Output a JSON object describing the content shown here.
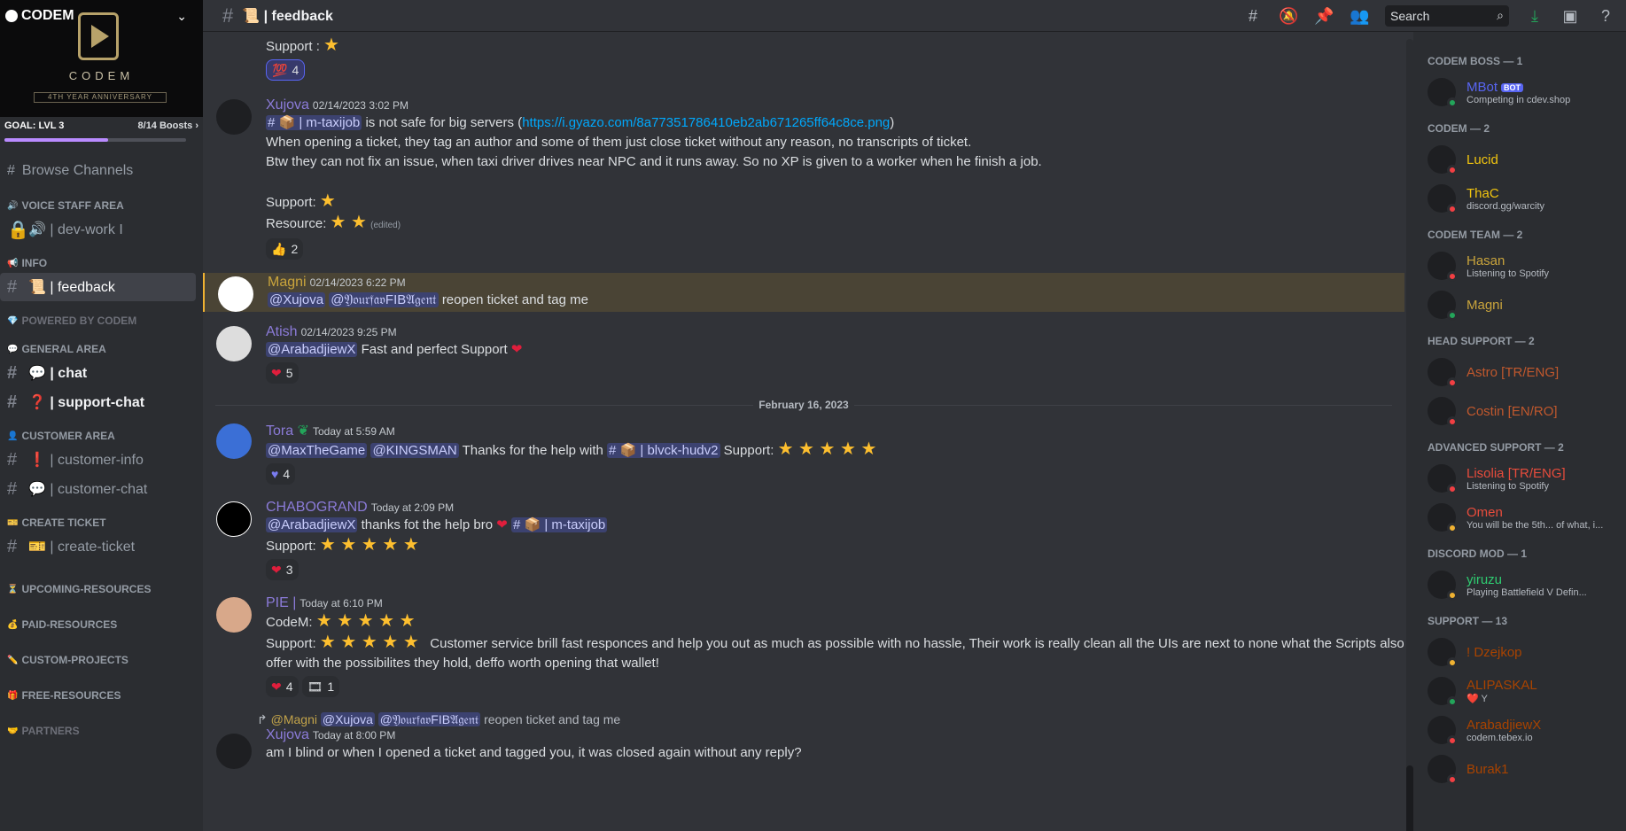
{
  "server": {
    "name": "CODEM",
    "logo_text": "CODEM",
    "logo_sub": "4TH YEAR ANNIVERSARY",
    "goal_label": "GOAL: LVL 3",
    "boosts": "8/14 Boosts",
    "goal_progress": 0.571
  },
  "sidebar": {
    "browse": "Browse Channels",
    "items": [
      {
        "type": "cat",
        "label": "VOICE STAFF AREA"
      },
      {
        "type": "chan",
        "label": "🔊 | dev-work I"
      },
      {
        "type": "cat",
        "label": "INFO"
      },
      {
        "type": "chan",
        "label": "📜 | feedback"
      },
      {
        "type": "cat",
        "label": "POWERED BY CODEM"
      },
      {
        "type": "cat",
        "label": "GENERAL AREA"
      },
      {
        "type": "chan",
        "label": "💬 | chat"
      },
      {
        "type": "chan",
        "label": "❓ | support-chat"
      },
      {
        "type": "cat",
        "label": "CUSTOMER AREA"
      },
      {
        "type": "chan",
        "label": "❗ | customer-info"
      },
      {
        "type": "chan",
        "label": "💬 | customer-chat"
      },
      {
        "type": "cat",
        "label": "CREATE TICKET"
      },
      {
        "type": "chan",
        "label": "🎫 | create-ticket"
      },
      {
        "type": "cat",
        "label": "UPCOMING-RESOURCES"
      },
      {
        "type": "cat",
        "label": "PAID-RESOURCES"
      },
      {
        "type": "cat",
        "label": "CUSTOM-PROJECTS"
      },
      {
        "type": "cat",
        "label": "FREE-RESOURCES"
      },
      {
        "type": "cat",
        "label": "PARTNERS"
      }
    ]
  },
  "header": {
    "channel": "📜 | feedback",
    "search_placeholder": "Search"
  },
  "messages": {
    "top_support": "Support :",
    "top_react_count": "4",
    "m1": {
      "author": "Xujova",
      "time": "02/14/2023 3:02 PM",
      "chan": "📦 | m-taxijob",
      "l1a": "is not safe for big servers (",
      "link": "https://i.gyazo.com/8a77351786410eb2ab671265ff64c8ce.png",
      "l1b": ")",
      "l2": "When opening a ticket, they tag an author and some of them just close ticket without any reason, no transcripts of ticket.",
      "l3": "Btw they can not fix an issue, when taxi driver drives near NPC and it runs away. So no XP is given to a worker when he finish a job.",
      "support": "Support:",
      "resource": "Resource:",
      "edited": "(edited)",
      "react": "2"
    },
    "m2": {
      "author": "Magni",
      "time": "02/14/2023 6:22 PM",
      "mention1": "@Xujova",
      "mention2": "@𝔜𝔬𝔲𝔯𝔣𝔞𝔳FIB𝔄𝔤𝔢𝔫𝔱",
      "text": "reopen ticket and tag me"
    },
    "m3": {
      "author": "Atish",
      "time": "02/14/2023 9:25 PM",
      "mention": "@ArabadjiewX",
      "text": "Fast and perfect Support",
      "react": "5"
    },
    "divider": "February 16, 2023",
    "m4": {
      "author": "Tora",
      "time": "Today at 5:59 AM",
      "mention1": "@MaxTheGame",
      "mention2": "@KINGSMAN",
      "text": "Thanks for the help with",
      "chan": "📦 | blvck-hudv2",
      "support": "Support:",
      "react": "4"
    },
    "m5": {
      "author": "CHABOGRAND",
      "time": "Today at 2:09 PM",
      "mention": "@ArabadjiewX",
      "text": "thanks fot the help bro",
      "chan": "📦 | m-taxijob",
      "support": "Support:",
      "react": "3"
    },
    "m6": {
      "author": "PIE |",
      "time": "Today at 6:10 PM",
      "codem": "CodeM:",
      "support": "Support:",
      "text": "Customer service brill  fast responces and help you out as much as possible with no hassle, Their work is really clean all the UIs are next to none what the Scripts also offer with the possibilites they hold, deffo worth opening that wallet!",
      "react1": "4",
      "react2": "1"
    },
    "m7": {
      "reply_author": "@Magni",
      "reply_m1": "@Xujova",
      "reply_m2": "@𝔜𝔬𝔲𝔯𝔣𝔞𝔳FIB𝔄𝔤𝔢𝔫𝔱",
      "reply_text": "reopen ticket and tag me",
      "author": "Xujova",
      "time": "Today at 8:00 PM",
      "text": "am I blind or when I opened a ticket and tagged you, it was closed again without any reply?"
    }
  },
  "members": [
    {
      "cat": "CODEM BOSS — 1",
      "list": [
        {
          "name": "MBot",
          "color": "#5865f2",
          "bot": "BOT",
          "act": "Competing in cdev.shop",
          "status": "online"
        }
      ]
    },
    {
      "cat": "CODEM — 2",
      "list": [
        {
          "name": "Lucid",
          "color": "#f1c40f",
          "act": "",
          "status": "dnd"
        },
        {
          "name": "ThaC",
          "color": "#f1c40f",
          "act": "discord.gg/warcity",
          "status": "dnd"
        }
      ]
    },
    {
      "cat": "CODEM TEAM — 2",
      "list": [
        {
          "name": "Hasan",
          "color": "#c9a43c",
          "act": "Listening to Spotify",
          "status": "dnd"
        },
        {
          "name": "Magni",
          "color": "#c9a43c",
          "act": "",
          "status": "online"
        }
      ]
    },
    {
      "cat": "HEAD SUPPORT — 2",
      "list": [
        {
          "name": "Astro [TR/ENG]",
          "color": "#c0582d",
          "act": "",
          "status": "dnd"
        },
        {
          "name": "Costin [EN/RO]",
          "color": "#c0582d",
          "act": "",
          "status": "dnd"
        }
      ]
    },
    {
      "cat": "ADVANCED SUPPORT — 2",
      "list": [
        {
          "name": "Lisolia [TR/ENG]",
          "color": "#e74c3c",
          "act": "Listening to Spotify",
          "status": "dnd"
        },
        {
          "name": "Omen",
          "color": "#e74c3c",
          "act": "You will be the 5th... of what, i...",
          "status": "idle"
        }
      ]
    },
    {
      "cat": "DISCORD MOD — 1",
      "list": [
        {
          "name": "yiruzu",
          "color": "#2ecc71",
          "act": "Playing Battlefield V Defin...",
          "status": "idle"
        }
      ]
    },
    {
      "cat": "SUPPORT — 13",
      "list": [
        {
          "name": "! Dzejkop",
          "color": "#a84300",
          "act": "",
          "status": "idle"
        },
        {
          "name": "ALIPASKAL",
          "color": "#a84300",
          "act": "❤️ Y",
          "status": "online"
        },
        {
          "name": "ArabadjiewX",
          "color": "#a84300",
          "act": "codem.tebex.io",
          "status": "dnd"
        },
        {
          "name": "Burak1",
          "color": "#a84300",
          "act": "",
          "status": "dnd"
        }
      ]
    }
  ]
}
